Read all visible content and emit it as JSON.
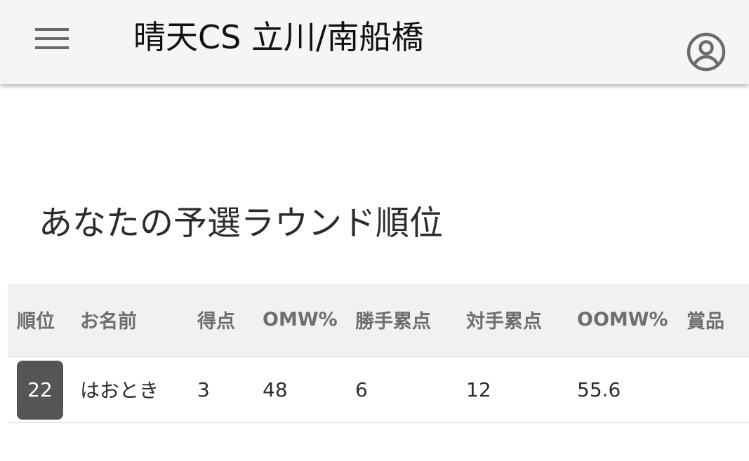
{
  "app_bar": {
    "menu_icon": "hamburger-menu-icon",
    "title": "晴天CS 立川/南船橋",
    "account_icon": "account-circle-icon",
    "background": "#f5f5f5"
  },
  "section": {
    "title": "あなたの予選ラウンド順位"
  },
  "standings": {
    "columns": [
      "順位",
      "お名前",
      "得点",
      "OMW%",
      "勝手累点",
      "対手累点",
      "OOMW%",
      "賞品"
    ],
    "rows": [
      {
        "rank": "22",
        "name": "はおとき",
        "points": "3",
        "omw": "48",
        "own_cumulative": "6",
        "opponent_cumulative": "12",
        "oomw": "55.6",
        "prize": ""
      }
    ],
    "rank_badge_color": "#555555",
    "header_background": "#f1f1f1"
  }
}
